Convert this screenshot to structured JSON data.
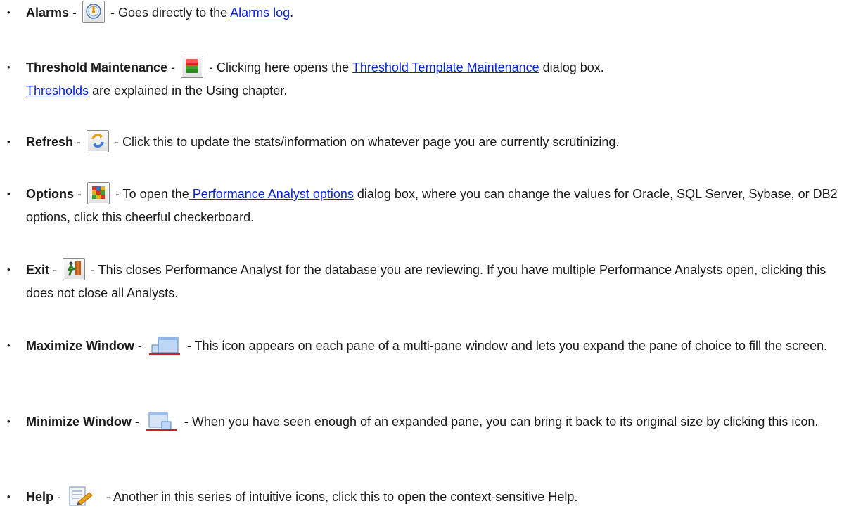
{
  "items": [
    {
      "term": "Alarms",
      "sep1": " - ",
      "after": " - Goes directly to the ",
      "link": "Alarms log",
      "tail": ".",
      "icon": "alarm-clock-icon"
    },
    {
      "term": "Threshold Maintenance",
      "sep1": " - ",
      "after": " - Clicking here opens the ",
      "link": "Threshold Template Maintenance",
      "tail": " dialog box.",
      "link2": "Thresholds",
      "tail2": " are explained in the Using chapter.",
      "icon": "database-cylinder-icon"
    },
    {
      "term": "Refresh",
      "sep1": " - ",
      "after": " - Click this to update the stats/information on whatever page you are currently scrutinizing.",
      "icon": "refresh-icon"
    },
    {
      "term": "Options",
      "sep1": " - ",
      "after": " - To open the",
      "link": " Performance Analyst options",
      "tail": " dialog box, where you can change the values for Oracle, SQL Server, Sybase, or DB2 options, click this cheerful checkerboard.",
      "icon": "checkerboard-icon"
    },
    {
      "term": "Exit",
      "sep1": " - ",
      "after": " - This closes Performance Analyst for the database you are reviewing. If you have multiple Performance Analysts open, clicking this does not close all Analysts.",
      "icon": "exit-door-icon"
    },
    {
      "term": "Maximize Window",
      "sep1": " - ",
      "after": " - This icon appears on each pane of a multi-pane window and lets you expand the pane of choice to fill the screen.",
      "icon": "maximize-window-icon"
    },
    {
      "term": "Minimize Window",
      "sep1": " - ",
      "after": " - When you have seen enough of an expanded pane, you can bring it back to its original size by clicking this icon.",
      "icon": "minimize-window-icon"
    },
    {
      "term": "Help",
      "sep1": " - ",
      "after": " - Another in this series of intuitive icons, click this to open the context-sensitive Help.",
      "icon": "help-icon"
    }
  ],
  "bullet": "•",
  "colors": {
    "link": "#0b24d6",
    "text": "#1a1a1a"
  }
}
